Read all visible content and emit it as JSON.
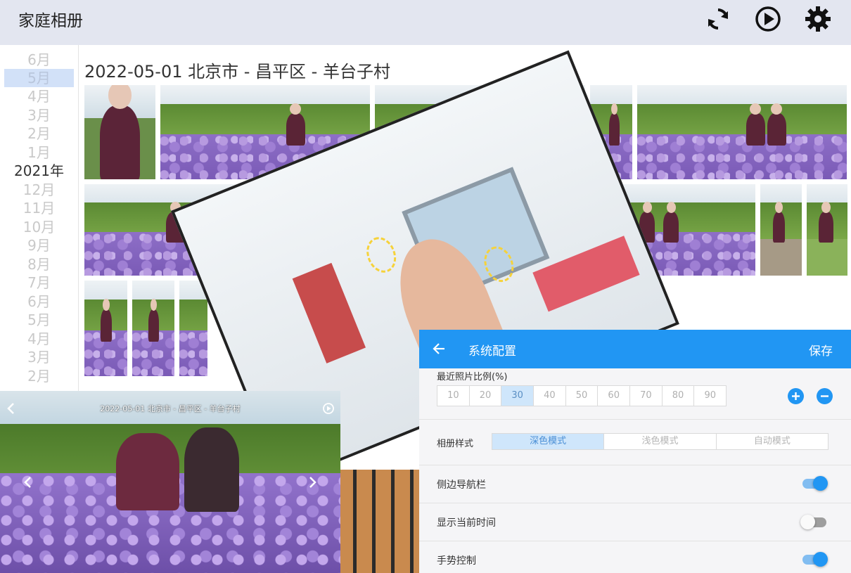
{
  "app": {
    "title": "家庭相册",
    "icons": [
      "refresh-icon",
      "play-icon",
      "gear-icon"
    ]
  },
  "sidebar": {
    "months": [
      "6月",
      "5月",
      "4月",
      "3月",
      "2月",
      "1月",
      "2021年",
      "12月",
      "11月",
      "10月",
      "9月",
      "8月",
      "7月",
      "6月",
      "5月",
      "4月",
      "3月",
      "2月"
    ],
    "selected": "5月"
  },
  "gallery": {
    "heading": "2022-05-01 北京市 - 昌平区 - 羊台子村"
  },
  "viewer": {
    "title": "2022-05-01 北京市 - 昌平区 - 羊台子村",
    "icons": [
      "back-chevron-icon",
      "play-circle-icon",
      "prev-chevron-icon",
      "next-chevron-icon"
    ]
  },
  "settings": {
    "title": "系统配置",
    "save_label": "保存",
    "recent_ratio": {
      "label": "最近照片比例(%)",
      "options": [
        "10",
        "20",
        "30",
        "40",
        "50",
        "60",
        "70",
        "80",
        "90"
      ],
      "selected": "30"
    },
    "album_style": {
      "label": "相册样式",
      "options": [
        "深色模式",
        "浅色模式",
        "自动模式"
      ],
      "selected": "深色模式"
    },
    "toggles": {
      "sidebar_nav": {
        "label": "侧边导航栏",
        "on": true
      },
      "show_time": {
        "label": "显示当前时间",
        "on": false
      },
      "gesture": {
        "label": "手势控制",
        "on": true
      }
    }
  },
  "colors": {
    "accent": "#2196f3",
    "header_bg": "#e3e6f0",
    "selected_month_bg": "#d2e1f8"
  }
}
